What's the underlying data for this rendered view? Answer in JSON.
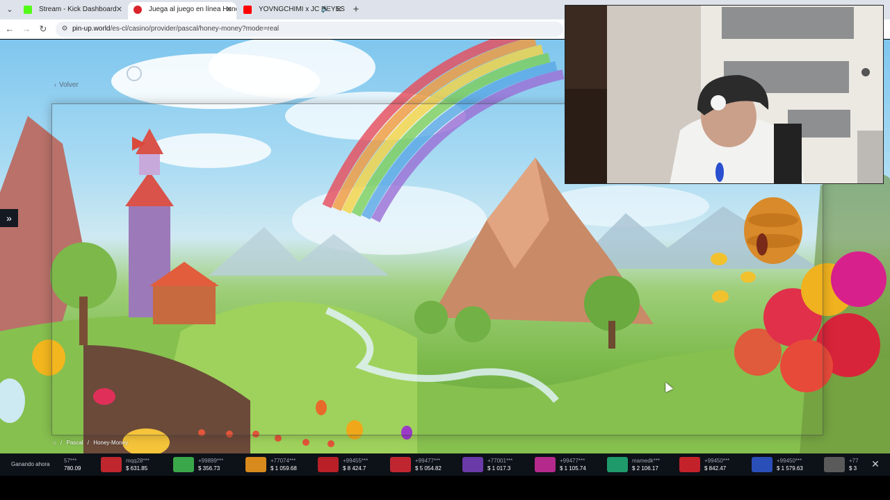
{
  "browser": {
    "tabs": [
      {
        "title": "Stream - Kick Dashboard",
        "favicon_color": "#53fc18",
        "active": false
      },
      {
        "title": "Juega al juego en línea Honey-",
        "favicon_color": "#d9242b",
        "active": true
      },
      {
        "title": "YOVNGCHIMI x JC REYES -",
        "favicon_color": "#ff0000",
        "active": false
      }
    ],
    "new_tab": "+",
    "url_host": "pin-up.world",
    "url_path": "/es-cl/casino/provider/pascal/honey-money?mode=real"
  },
  "page": {
    "back_label": "Volver",
    "side_toggle": "»",
    "breadcrumb": [
      "⌂",
      "/",
      "Pascal",
      "/",
      "Honey-Money"
    ]
  },
  "ticker": {
    "label": "Ganando ahora",
    "close": "✕",
    "wins": [
      {
        "user": "57***",
        "amount": "780.09",
        "color": "#8a5a2a"
      },
      {
        "user": "mqq28***",
        "amount": "$ 631.85",
        "color": "#c0262d"
      },
      {
        "user": "+99899***",
        "amount": "$ 356.73",
        "color": "#3aa84a"
      },
      {
        "user": "+77074***",
        "amount": "$ 1 059.68",
        "color": "#d88a1c"
      },
      {
        "user": "+99455***",
        "amount": "$ 8 424.7",
        "color": "#b81f26"
      },
      {
        "user": "+99477***",
        "amount": "$ 5 054.82",
        "color": "#c02630"
      },
      {
        "user": "+77001***",
        "amount": "$ 1 017.3",
        "color": "#6a3aa8"
      },
      {
        "user": "+99477***",
        "amount": "$ 1 105.74",
        "color": "#b42a8c"
      },
      {
        "user": "mamedk***",
        "amount": "$ 2 106.17",
        "color": "#1f9a6a"
      },
      {
        "user": "+99450***",
        "amount": "$ 842.47",
        "color": "#c4222a"
      },
      {
        "user": "+99450***",
        "amount": "$ 1 579.63",
        "color": "#2a4fb8"
      },
      {
        "user": "+77",
        "amount": "$ 3",
        "color": "#5a5a5a"
      }
    ]
  },
  "colors": {
    "ticker_bg": "#0d1118",
    "tabbar_bg": "#dee3eb"
  }
}
